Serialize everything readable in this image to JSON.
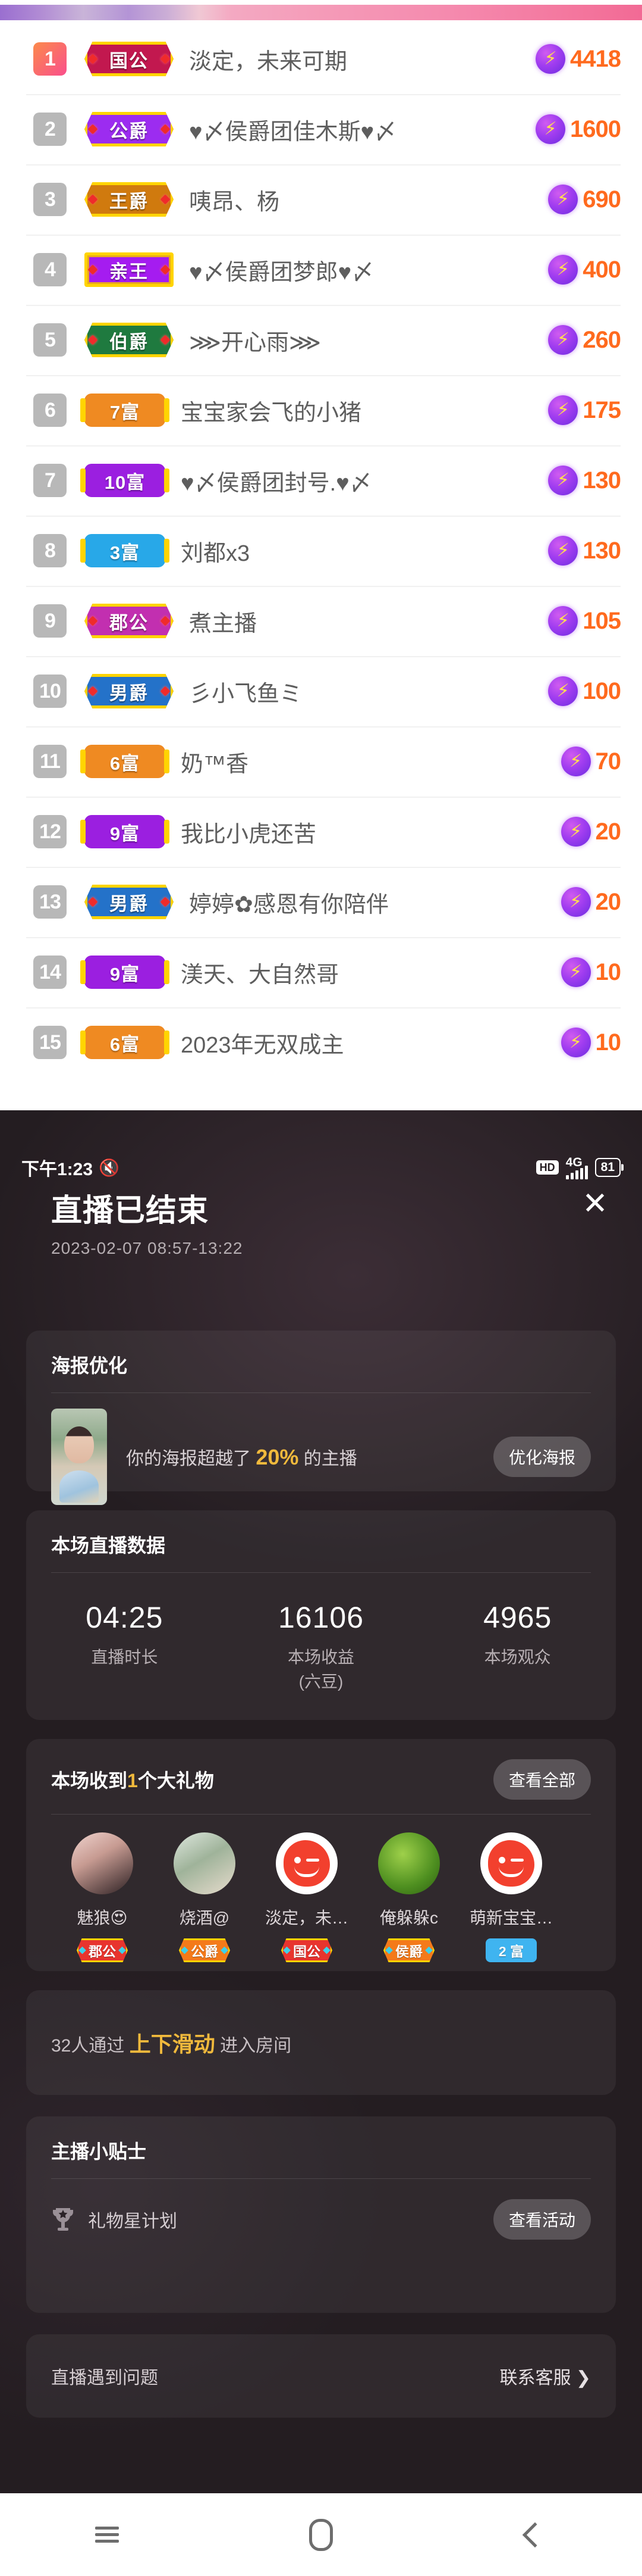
{
  "rank_list": {
    "rows": [
      {
        "rank": "1",
        "badge": {
          "text": "国公",
          "kind": "noble",
          "bg": "#c2184f"
        },
        "name": "淡定，未来可期",
        "score": "4418"
      },
      {
        "rank": "2",
        "badge": {
          "text": "公爵",
          "kind": "noble",
          "bg": "#9c2cf0"
        },
        "name": "♥〆侯爵团佳木斯♥〆",
        "score": "1600"
      },
      {
        "rank": "3",
        "badge": {
          "text": "王爵",
          "kind": "noble",
          "bg": "#d07a0e"
        },
        "name": "咦昂、杨",
        "score": "690"
      },
      {
        "rank": "4",
        "badge": {
          "text": "亲王",
          "kind": "crown",
          "bg": "#a51cf0"
        },
        "name": "♥〆侯爵团梦郎♥〆",
        "score": "400"
      },
      {
        "rank": "5",
        "badge": {
          "text": "伯爵",
          "kind": "noble",
          "bg": "#1f7a3f"
        },
        "name": "⋙开心雨⋙",
        "score": "260"
      },
      {
        "rank": "6",
        "badge": {
          "text": "7富",
          "kind": "wealth",
          "bg": "#ef8a22"
        },
        "name": "宝宝家会飞的小猪",
        "score": "175"
      },
      {
        "rank": "7",
        "badge": {
          "text": "10富",
          "kind": "wealth",
          "bg": "#9b1fe0"
        },
        "name": "♥〆侯爵团封号.♥〆",
        "score": "130"
      },
      {
        "rank": "8",
        "badge": {
          "text": "3富",
          "kind": "wealth",
          "bg": "#28a8e8"
        },
        "name": "刘都x3",
        "score": "130"
      },
      {
        "rank": "9",
        "badge": {
          "text": "郡公",
          "kind": "noble",
          "bg": "#c22fb0"
        },
        "name": "煮主播",
        "score": "105"
      },
      {
        "rank": "10",
        "badge": {
          "text": "男爵",
          "kind": "noble",
          "bg": "#2472c9"
        },
        "name": "彡小飞鱼ミ",
        "score": "100"
      },
      {
        "rank": "11",
        "badge": {
          "text": "6富",
          "kind": "wealth",
          "bg": "#ef8a22"
        },
        "name": "奶™香",
        "score": "70"
      },
      {
        "rank": "12",
        "badge": {
          "text": "9富",
          "kind": "wealth",
          "bg": "#9b1fe0"
        },
        "name": "我比小虎还苦",
        "score": "20"
      },
      {
        "rank": "13",
        "badge": {
          "text": "男爵",
          "kind": "noble",
          "bg": "#2472c9"
        },
        "name": "婷婷✿感恩有你陪伴",
        "score": "20"
      },
      {
        "rank": "14",
        "badge": {
          "text": "9富",
          "kind": "wealth",
          "bg": "#9b1fe0"
        },
        "name": "渼天、大自然哥",
        "score": "10"
      },
      {
        "rank": "15",
        "badge": {
          "text": "6富",
          "kind": "wealth",
          "bg": "#ef8a22"
        },
        "name": "2023年无双成主",
        "score": "10"
      }
    ],
    "bolt_glyph": "⚡"
  },
  "live_end": {
    "statusbar": {
      "time": "下午1:23",
      "mute_icon": "🔇",
      "hd": "HD",
      "network": "4G",
      "battery": "81"
    },
    "title": "直播已结束",
    "close_glyph": "✕",
    "date_range": "2023-02-07 08:57-13:22",
    "poster": {
      "title": "海报优化",
      "text_before": "你的海报超越了 ",
      "percent": "20%",
      "text_after": " 的主播",
      "button": "优化海报"
    },
    "stats": {
      "title": "本场直播数据",
      "items": [
        {
          "value": "04:25",
          "label": "直播时长"
        },
        {
          "value": "16106",
          "label": "本场收益\n(六豆)"
        },
        {
          "value": "4965",
          "label": "本场观众"
        }
      ]
    },
    "gifts": {
      "title_before": "本场收到",
      "count": "1",
      "title_after": "个大礼物",
      "view_all": "查看全部",
      "senders": [
        {
          "name": "魅狼😍",
          "badge": {
            "text": "郡公",
            "kind": "noble",
            "bg": "#e8342e"
          },
          "avatar": "av1"
        },
        {
          "name": "烧酒@",
          "badge": {
            "text": "公爵",
            "kind": "noble",
            "bg": "#f47a1a"
          },
          "avatar": "av2"
        },
        {
          "name": "淡定，未…",
          "badge": {
            "text": "国公",
            "kind": "noble",
            "bg": "#e8342e"
          },
          "avatar": "av3"
        },
        {
          "name": "俺躲躲c",
          "badge": {
            "text": "侯爵",
            "kind": "noble",
            "bg": "#f47a1a"
          },
          "avatar": "av4"
        },
        {
          "name": "萌新宝宝…",
          "badge": {
            "text": "2 富",
            "kind": "wealth",
            "bg": "#3fb4f0"
          },
          "avatar": "av5"
        }
      ]
    },
    "enter_room": {
      "before": "32人通过 ",
      "highlight": "上下滑动",
      "after": " 进入房间"
    },
    "tips": {
      "title": "主播小贴士",
      "item_label": "礼物星计划",
      "button": "查看活动"
    },
    "support": {
      "label": "直播遇到问题",
      "action": "联系客服 ❯"
    }
  },
  "navbar": {
    "recent": "recent-apps",
    "home": "home",
    "back": "back"
  }
}
